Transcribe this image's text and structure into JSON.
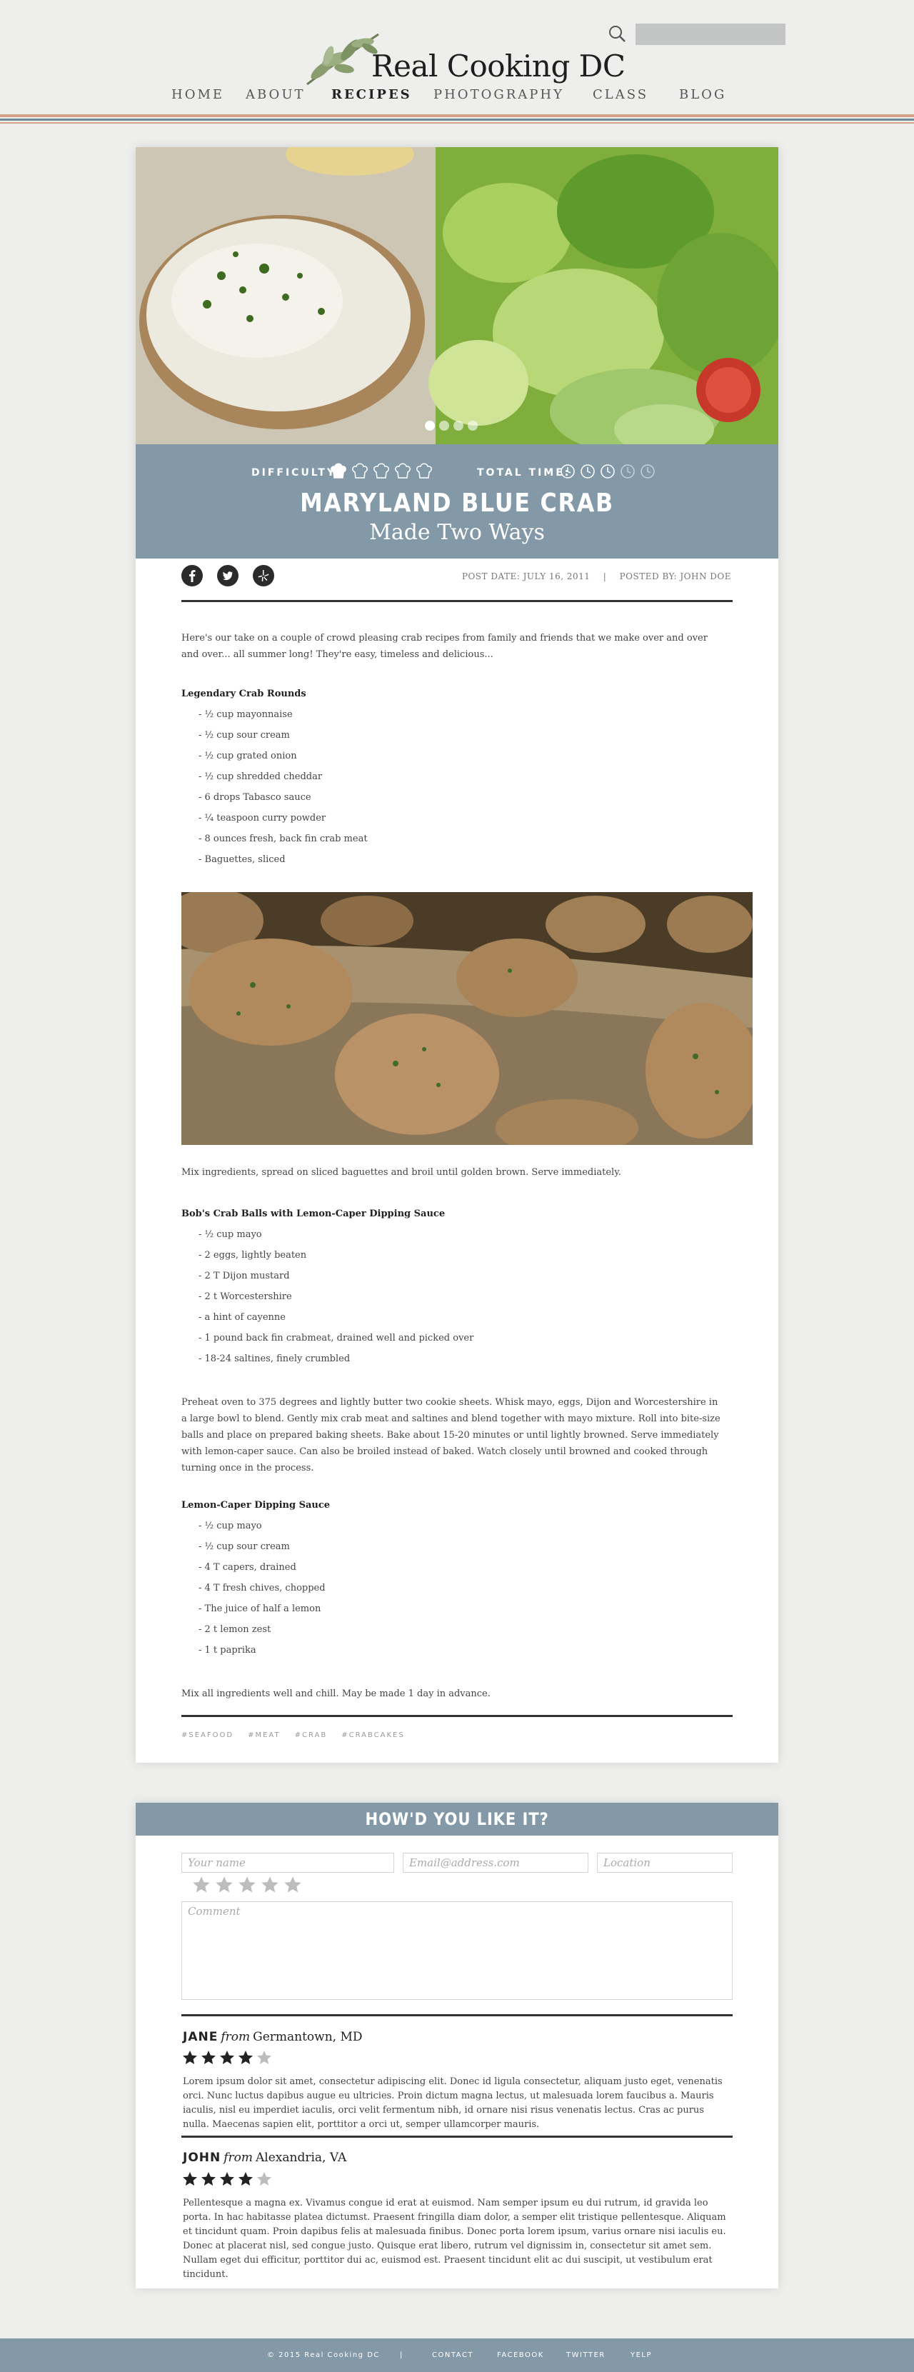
{
  "header": {
    "site_title": "Real Cooking DC",
    "search_placeholder": "",
    "nav": [
      {
        "label": "HOME"
      },
      {
        "label": "ABOUT"
      },
      {
        "label": "RECIPES",
        "active": true
      },
      {
        "label": "PHOTOGRAPHY"
      },
      {
        "label": "CLASS"
      },
      {
        "label": "BLOG"
      }
    ]
  },
  "recipe": {
    "difficulty_label": "DIFFICULTY:",
    "difficulty_level": 0.2,
    "total_time_label": "TOTAL TIME:",
    "total_time_level": 0.6,
    "title": "MARYLAND BLUE CRAB",
    "subtitle": "Made Two Ways",
    "slider_dots": 4,
    "slider_active": 1,
    "post_date": "POST DATE: JULY 16, 2011",
    "separator": "|",
    "posted_by": "POSTED BY: JOHN DOE",
    "intro": "Here's our take on a couple of crowd pleasing crab recipes from family and friends that we make over and over and over... all summer long! They're easy, timeless and delicious...",
    "section1": {
      "title": "Legendary Crab Rounds",
      "items": [
        "- ½ cup mayonnaise",
        "- ½ cup sour cream",
        "- ½ cup grated onion",
        "- ½ cup shredded cheddar",
        "- 6 drops Tabasco sauce",
        "- ¼ teaspoon curry powder",
        "- 8 ounces fresh, back fin crab meat",
        "- Baguettes, sliced"
      ],
      "note": "Mix ingredients, spread on sliced baguettes and broil until golden brown. Serve immediately."
    },
    "section2": {
      "title": "Bob's Crab Balls with Lemon-Caper Dipping Sauce",
      "items": [
        "- ½ cup mayo",
        "- 2 eggs, lightly beaten",
        "- 2 T Dijon mustard",
        "- 2 t Worcestershire",
        "- a hint of cayenne",
        "- 1 pound back fin crabmeat, drained well and picked over",
        "- 18-24 saltines, finely crumbled"
      ],
      "note": "Preheat oven to 375 degrees and lightly butter two cookie sheets. Whisk mayo, eggs, Dijon and Worcestershire in a large bowl to blend. Gently mix crab meat and saltines and blend together with mayo mixture. Roll into bite-size balls and place on prepared baking sheets. Bake about 15-20 minutes or until lightly browned. Serve immediately with lemon-caper sauce. Can also be broiled instead of baked. Watch closely until browned and cooked through turning once in the process."
    },
    "section3": {
      "title": "Lemon-Caper Dipping Sauce",
      "items": [
        "- ½ cup mayo",
        "- ½ cup sour cream",
        "- 4 T capers, drained",
        "- 4 T fresh chives, chopped",
        "- The juice of half a lemon",
        "- 2 t lemon zest",
        "- 1 t paprika"
      ],
      "note": "Mix all ingredients well and chill. May be made 1 day in advance."
    },
    "tags": [
      "#SEAFOOD",
      "#MEAT",
      "#CRAB",
      "#CRABCAKES"
    ]
  },
  "comments": {
    "heading": "HOW'D YOU LIKE IT?",
    "name_placeholder": "Your name",
    "email_placeholder": "Email@address.com",
    "location_placeholder": "Location",
    "comment_placeholder": "Comment",
    "rating_input_stars": 5,
    "reviews": [
      {
        "name": "JANE",
        "from": "from",
        "location": "Germantown, MD",
        "rating": 4,
        "text": "Lorem ipsum dolor sit amet, consectetur adipiscing elit. Donec id ligula consectetur, aliquam justo eget, venenatis orci. Nunc luctus dapibus augue eu ultricies. Proin dictum magna lectus, ut malesuada lorem faucibus a. Mauris iaculis, nisl eu imperdiet iaculis, orci velit fermentum nibh, id ornare nisi risus venenatis lectus. Cras ac purus nulla. Maecenas sapien elit, porttitor a orci ut, semper ullamcorper mauris."
      },
      {
        "name": "JOHN",
        "from": "from",
        "location": "Alexandria, VA",
        "rating": 4,
        "text": "Pellentesque a magna ex. Vivamus congue id erat at euismod. Nam semper ipsum eu dui rutrum, id gravida leo porta. In hac habitasse platea dictumst. Praesent fringilla diam dolor, a semper elit tristique pellentesque. Aliquam et tincidunt quam. Proin dapibus felis at malesuada finibus. Donec porta lorem ipsum, varius ornare nisi iaculis eu. Donec at placerat nisl, sed congue justo. Quisque erat libero, rutrum vel dignissim in, consectetur sit amet sem. Nullam eget dui efficitur, porttitor dui ac, euismod est. Praesent tincidunt elit ac dui suscipit, ut vestibulum erat tincidunt."
      }
    ]
  },
  "footer": {
    "copyright": "© 2015 Real Cooking DC",
    "separator": "|",
    "links": [
      "CONTACT",
      "FACEBOOK",
      "TWITTER",
      "YELP"
    ]
  },
  "colors": {
    "accent_blue": "#8399a7",
    "stripe_orange": "#d3a08a",
    "stripe_teal": "#6e8a96",
    "star": "#222"
  },
  "icons": [
    "search-icon",
    "olive-branch-logo",
    "chef-hat-icon",
    "clock-icon",
    "facebook-icon",
    "twitter-icon",
    "yelp-icon",
    "star-icon"
  ]
}
